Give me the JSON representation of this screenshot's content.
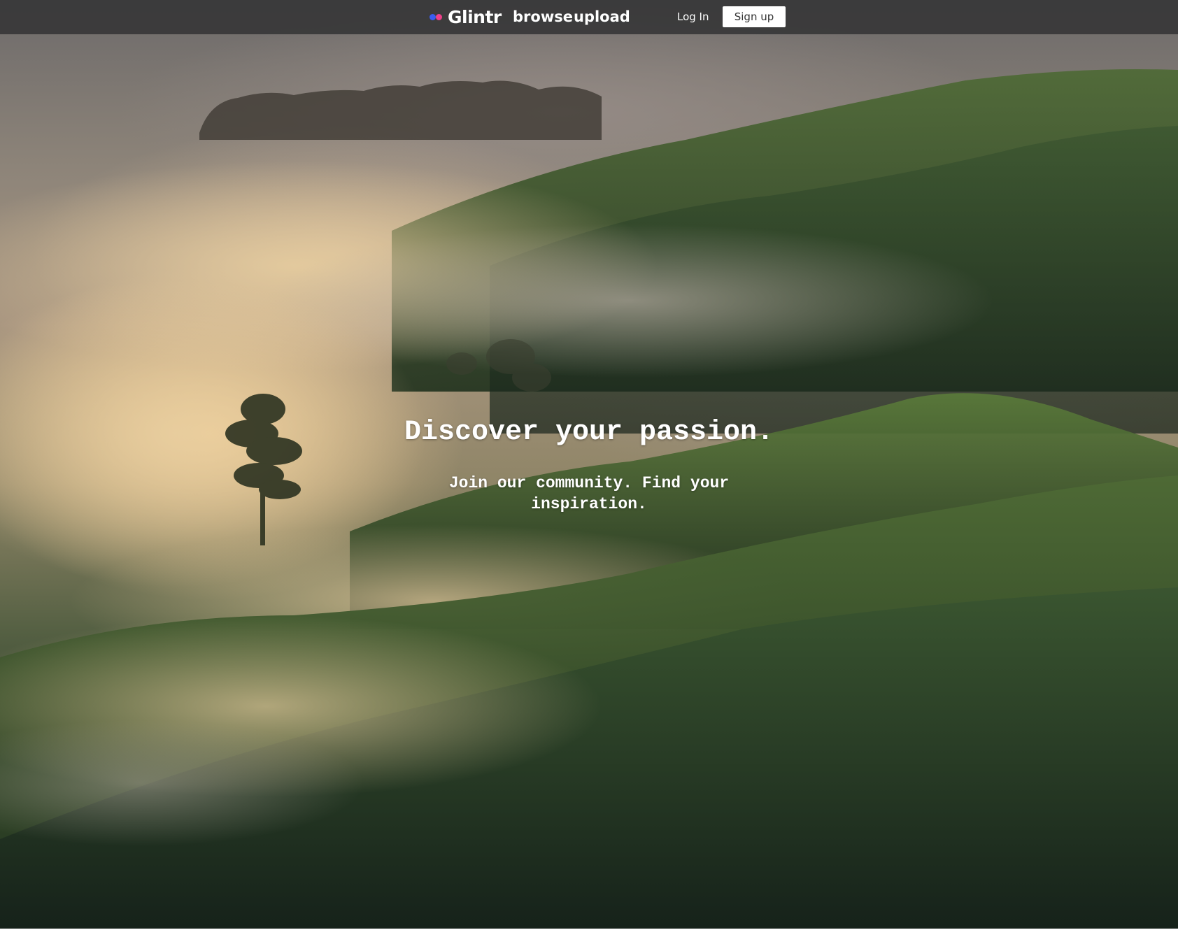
{
  "navbar": {
    "brand": "Glintr",
    "links": [
      "browse",
      "upload"
    ],
    "login_label": "Log In",
    "signup_label": "Sign up"
  },
  "hero": {
    "title": "Discover your passion.",
    "subtitle": "Join our community. Find your inspiration."
  },
  "colors": {
    "navbar_bg": "#343436",
    "brand_dot_blue": "#3a5df0",
    "brand_dot_pink": "#ef3f8a",
    "text": "#ffffff"
  }
}
